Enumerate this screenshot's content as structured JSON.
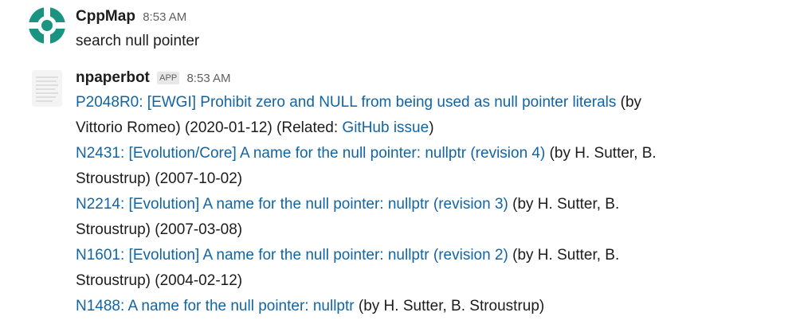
{
  "messages": [
    {
      "author": "CppMap",
      "time": "8:53 AM",
      "text": "search null pointer"
    },
    {
      "author": "npaperbot",
      "badge": "APP",
      "time": "8:53 AM",
      "results": [
        {
          "link": "P2048R0: [EWGI] Prohibit zero and NULL from being used as null pointer literals",
          "tail1": " (by",
          "line2_pre": "Vittorio Romeo) (2020-01-12) (Related: ",
          "line2_link": "GitHub issue",
          "line2_post": ")"
        },
        {
          "link": "N2431: [Evolution/Core] A name for the null pointer: nullptr (revision 4)",
          "tail1": " (by H. Sutter, B.",
          "line2": "Stroustrup) (2007-10-02)"
        },
        {
          "link": "N2214: [Evolution] A name for the null pointer: nullptr (revision 3)",
          "tail1": " (by H. Sutter, B.",
          "line2": "Stroustrup) (2007-03-08)"
        },
        {
          "link": "N1601: [Evolution] A name for the null pointer: nullptr (revision 2)",
          "tail1": " (by H. Sutter, B.",
          "line2": "Stroustrup) (2004-02-12)"
        },
        {
          "link": "N1488: A name for the null pointer: nullptr",
          "tail1": " (by H. Sutter, B. Stroustrup)"
        }
      ]
    }
  ],
  "colors": {
    "link": "#1264a3",
    "avatar_teal": "#1a9480",
    "text": "#1d1c1d",
    "muted": "#616061"
  },
  "icons": {
    "cppmap_avatar": "cppmap-logo-icon",
    "npaperbot_avatar": "document-icon"
  }
}
